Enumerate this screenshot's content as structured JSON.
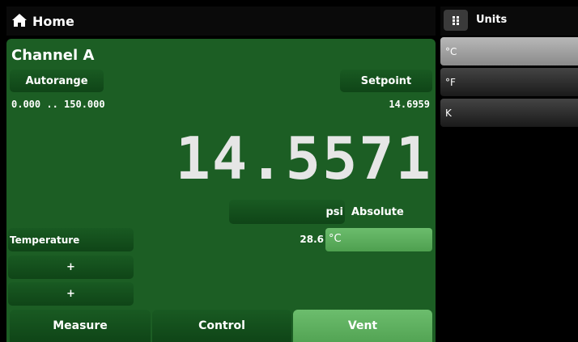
{
  "header": {
    "title": "Home",
    "icon": "home-icon"
  },
  "units_panel": {
    "title": "Units",
    "grid_icon": "grid-icon",
    "items": [
      "°C",
      "°F",
      "K"
    ],
    "selected": "°C"
  },
  "channel": {
    "title": "Channel A",
    "autorange_label": "Autorange",
    "setpoint_label": "Setpoint",
    "range": "0.000 .. 150.000",
    "setpoint_value": "14.6959",
    "reading": "14.5571",
    "unit": "psi",
    "mode": "Absolute",
    "temperature_label": "Temperature",
    "temperature_value": "28.6",
    "temperature_unit": "°C",
    "extra_buttons": [
      "+",
      "+"
    ]
  },
  "tabs": [
    {
      "label": "Measure"
    },
    {
      "label": "Control"
    },
    {
      "label": "Vent",
      "active": true
    }
  ],
  "colors": {
    "panel": "#1c5e24",
    "active_green": "#5bab5c",
    "selected_unit": "#a0a0a0"
  }
}
